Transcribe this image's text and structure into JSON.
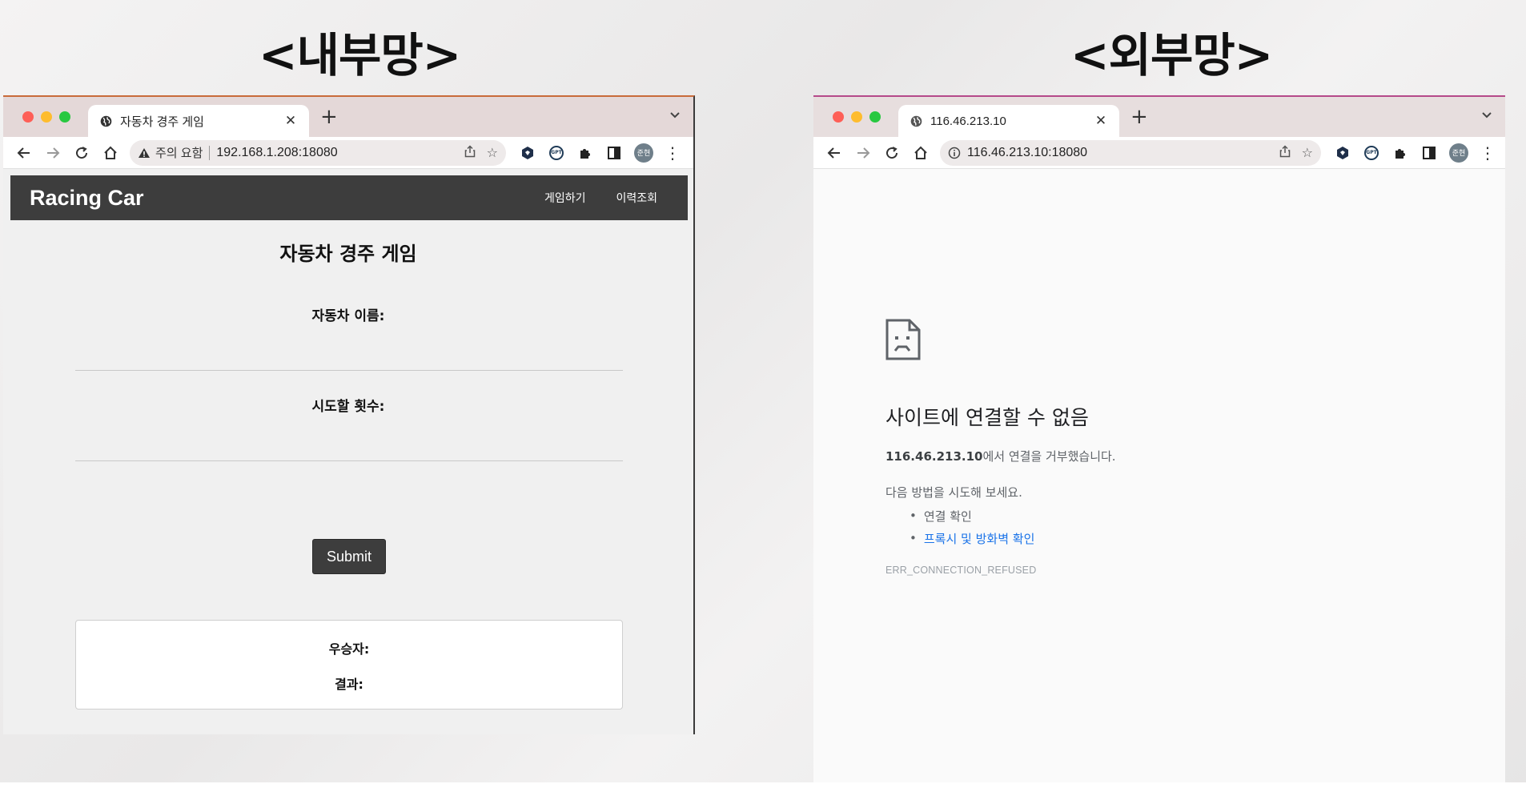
{
  "headings": {
    "left": "<내부망>",
    "right": "<외부망>"
  },
  "left_browser": {
    "tab_title": "자동차 경주 게임",
    "warning_label": "주의 요함",
    "url": "192.168.1.208:18080",
    "avatar_text": "준현",
    "page": {
      "brand": "Racing Car",
      "nav_links": [
        "게임하기",
        "이력조회"
      ],
      "title": "자동차 경주 게임",
      "car_name_label": "자동차 이름:",
      "car_name_value": "",
      "attempts_label": "시도할 횟수:",
      "attempts_value": "",
      "submit_label": "Submit",
      "winner_label": "우승자:",
      "result_label": "결과:"
    }
  },
  "right_browser": {
    "tab_title": "116.46.213.10",
    "url": "116.46.213.10:18080",
    "avatar_text": "준현",
    "error": {
      "title": "사이트에 연결할 수 없음",
      "host": "116.46.213.10",
      "message_suffix": "에서 연결을 거부했습니다.",
      "try_text": "다음 방법을 시도해 보세요.",
      "suggestions": [
        "연결 확인",
        "프록시 및 방화벽 확인"
      ],
      "code": "ERR_CONNECTION_REFUSED"
    }
  },
  "icons": {
    "traffic_lights": [
      "#fe5f57",
      "#febc2e",
      "#28c840"
    ],
    "toolbar": [
      "back-arrow-icon",
      "forward-arrow-icon",
      "reload-icon",
      "home-icon",
      "share-icon",
      "bookmark-star-icon",
      "extension-icon",
      "gpt-extension-icon",
      "puzzle-extensions-icon",
      "side-panel-icon",
      "kebab-menu-icon"
    ]
  },
  "colors": {
    "navbar": "#3d3d3d",
    "link": "#1a73e8",
    "page_bg": "#f0f0f0"
  }
}
